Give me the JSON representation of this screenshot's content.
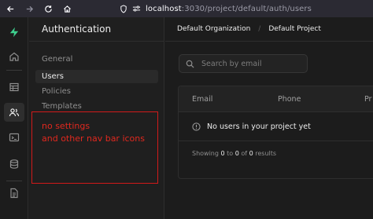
{
  "browser": {
    "back_icon": "arrow-left-icon",
    "forward_icon": "arrow-right-icon",
    "reload_icon": "reload-icon",
    "home_icon": "home-icon",
    "url_host": "localhost",
    "url_path": ":3030/project/default/auth/users"
  },
  "rail": {
    "items": [
      "logo",
      "home",
      "table-editor",
      "authentication",
      "sql-editor",
      "database",
      "docs"
    ],
    "active": "authentication"
  },
  "menu": {
    "title": "Authentication",
    "items": [
      {
        "label": "General",
        "active": false
      },
      {
        "label": "Users",
        "active": true
      },
      {
        "label": "Policies",
        "active": false
      },
      {
        "label": "Templates",
        "active": false
      }
    ]
  },
  "annotation": {
    "line1": "no settings",
    "line2": "and other nav bar icons",
    "color": "#d11a1a"
  },
  "breadcrumb": {
    "organization": "Default Organization",
    "project": "Default Project"
  },
  "search": {
    "placeholder": "Search by email"
  },
  "table": {
    "columns": [
      "Email",
      "Phone",
      "Pr"
    ],
    "empty_message": "No users in your project yet",
    "footer": {
      "prefix": "Showing ",
      "from": "0",
      "to_word": " to ",
      "to": "0",
      "of_word": " of ",
      "total": "0",
      "suffix": " results"
    }
  }
}
